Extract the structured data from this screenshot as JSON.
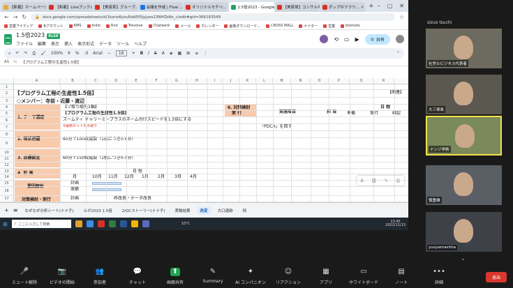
{
  "browser": {
    "tabs": [
      {
        "label": "【新着】ホームページ ... ",
        "color": "#e8a838"
      },
      {
        "label": "【新着】Lineブックレ...",
        "color": "#d93025"
      },
      {
        "label": "【美容系】グループ...",
        "color": "#d93025"
      },
      {
        "label": "会議を作成 | Flow ...",
        "color": "#1a73e8"
      },
      {
        "label": "オリジナルモチベ...",
        "color": "#d93025"
      },
      {
        "label": "1.5倍2023 - Google...",
        "color": "#1fa463"
      },
      {
        "label": "【美容体】コンサルの...",
        "color": "#d93025"
      },
      {
        "label": "ポップのフラワ...",
        "color": "#d93025"
      }
    ],
    "url": "docs.google.com/spreadsheets/d/1kanoKyouRdd5f5Jyjyes23NHZbNs_c/edit#gid=366163549",
    "bookmarks": [
      "営業アイディア",
      "Bアカウント",
      "KMS",
      "Indio",
      "Rnd",
      "Trevolve",
      "Chatwork",
      "メール",
      "カレンダー",
      "画像ダウンロード...",
      "CROSS MALL",
      "ナイター",
      "営業",
      "biomoto"
    ]
  },
  "sheet": {
    "doc_title": "1.5倍2023",
    "badge": "XLSX",
    "menus": [
      "ファイル",
      "編集",
      "表示",
      "挿入",
      "表示形式",
      "データ",
      "ツール",
      "ヘルプ"
    ],
    "share_label": "共有",
    "zoom": "100%",
    "font": "Arial",
    "font_size": "16",
    "cell_ref": "A1",
    "formula": "【プログラム工程の生産性1.5倍】",
    "columns": [
      "A",
      "B",
      "C",
      "D",
      "E",
      "F",
      "G",
      "H",
      "I",
      "J",
      "K",
      "L",
      "M",
      "N",
      "O",
      "P",
      "Q",
      "R"
    ],
    "rows": [
      "1",
      "2",
      "3",
      "4",
      "5",
      "6",
      "7",
      "8",
      "9",
      "10",
      "11",
      "12",
      "13",
      "14",
      "15",
      "16",
      "17"
    ],
    "cells": {
      "title": "【プログラム工程の生産性1.5倍】",
      "members": "○メンバー：寺前・近藤・渡辺",
      "header_right": "【関連】",
      "item1": "1. テーマ選定",
      "item1_note": "【ゾ取り組先1軸】",
      "item1_theme": "【プログラム工程の生産性1.5倍】",
      "item1_desc": "ズームティ キャリーミープラスのネーム付けスピードを1.5倍にする",
      "item1_red": "※最新セットのみ取り",
      "item2": "2. 現状把握",
      "item2_desc": "60分で100枚縫製（1枚につき0.6分）",
      "item3": "3. 目標設定",
      "item3_desc": "60分で150枚縫製（1枚につき0.4分）",
      "item4": "4. 計 画",
      "schedule": "日 程",
      "month_label": "月",
      "months": [
        "10月",
        "11月",
        "12月",
        "1月",
        "2月",
        "3月",
        "4月"
      ],
      "analysis": "要因解析",
      "plan": "計画",
      "actual": "実績",
      "plan2": "計画",
      "task_note": "枠改良・データ改良",
      "counter": "対策検討・実行",
      "sec6": "6. 対策検討",
      "sec6b": "実 行",
      "implement": "実施項目",
      "owner": "担 当",
      "schedule2": "日 程",
      "prep": "準備",
      "exec": "実行",
      "verify": "確認",
      "pdca": "「PDCA」を回す"
    },
    "sheet_tabs": [
      "なぜなぜ分析シート(ナナ子)",
      "ルが2023 1.5倍",
      "2/QCストーリー(ナナ子)",
      "実験結果",
      "改変",
      "大口遺跡",
      "特"
    ]
  },
  "taskbar": {
    "search_placeholder": "ここに入力して検索",
    "weather": "10°C",
    "time": "13:45",
    "date": "2022/11/13"
  },
  "meeting": {
    "top_name": "sizuo tsuchi",
    "participants": [
      {
        "name": "社労士ビジネス代表者"
      },
      {
        "name": "大三塚島"
      },
      {
        "name": "ナンジ学術"
      },
      {
        "name": "慎重雄"
      },
      {
        "name": "yuuyamashita"
      }
    ],
    "controls": [
      {
        "label": "ミュート解除",
        "icon": "🎤"
      },
      {
        "label": "ビデオの開始",
        "icon": "📷"
      },
      {
        "label": "参加者",
        "icon": "👥"
      },
      {
        "label": "チャット",
        "icon": "💬"
      },
      {
        "label": "画面共有",
        "icon": "⬆"
      },
      {
        "label": "Summary",
        "icon": "✎"
      },
      {
        "label": "AI コンパニオン",
        "icon": "✦"
      },
      {
        "label": "リアクション",
        "icon": "☺"
      },
      {
        "label": "アプリ",
        "icon": "▦"
      },
      {
        "label": "ホワイトボード",
        "icon": "▭"
      },
      {
        "label": "ノート",
        "icon": "▤"
      },
      {
        "label": "詳細",
        "icon": "•••"
      }
    ],
    "participant_count": "11",
    "end_label": "退出"
  }
}
